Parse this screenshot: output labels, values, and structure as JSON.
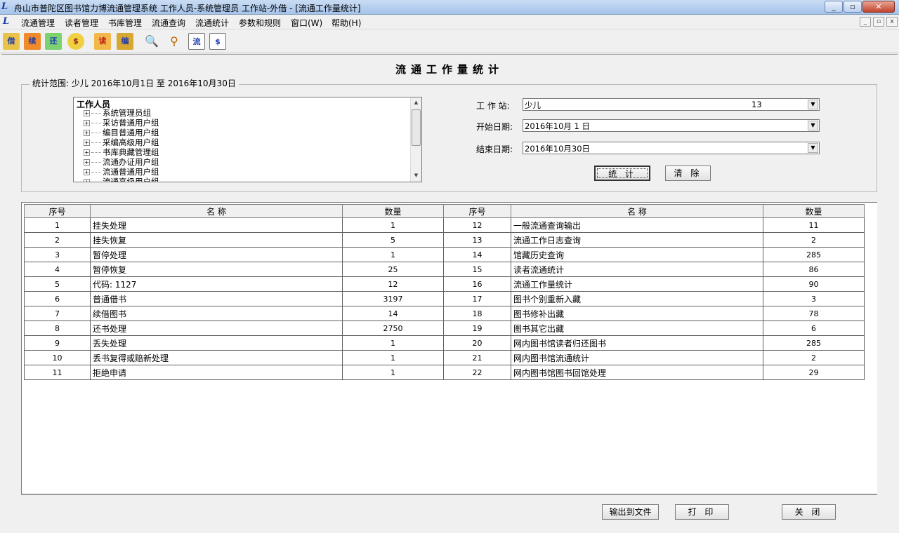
{
  "window": {
    "title": "舟山市普陀区图书馆力博流通管理系统 工作人员-系统管理员 工作站-外借 - [流通工作量统计]",
    "minimize": "_",
    "maximize": "▫",
    "close": "✕"
  },
  "menu": {
    "items": [
      "流通管理",
      "读者管理",
      "书库管理",
      "流通查询",
      "流通统计",
      "参数和规则",
      "窗口(W)",
      "帮助(H)"
    ]
  },
  "toolbar": {
    "icons": [
      "borrow-icon",
      "renew-icon",
      "return-icon",
      "fine-icon",
      "reader-register-icon",
      "catalog-icon",
      "search-icon",
      "finance-search-icon",
      "circulation-chart-icon",
      "money-chart-icon"
    ],
    "labels": [
      "借",
      "续",
      "还",
      "$",
      "读",
      "编",
      "",
      "",
      "流",
      "$"
    ]
  },
  "page": {
    "title": "流通工作量统计"
  },
  "range": {
    "legend": "统计范围:  少儿  2016年10月1日  至  2016年10月30日"
  },
  "tree": {
    "root": "工作人员",
    "items": [
      "系统管理员组",
      "采访普通用户组",
      "编目普通用户组",
      "采编高级用户组",
      "书库典藏管理组",
      "流通办证用户组",
      "流通普通用户组",
      "流通高级用户组"
    ]
  },
  "form": {
    "station_label": "工 作 站:",
    "station_value": "少儿",
    "station_code": "13",
    "start_label": "开始日期:",
    "start_value": "2016年10月 1 日",
    "end_label": "结束日期:",
    "end_value": "2016年10月30日",
    "stat_button": "统 计",
    "clear_button": "清 除"
  },
  "grid": {
    "headers": [
      "序号",
      "名    称",
      "数量",
      "序号",
      "名    称",
      "数量"
    ],
    "left_rows": [
      {
        "no": "1",
        "name": "挂失处理",
        "qty": "1"
      },
      {
        "no": "2",
        "name": "挂失恢复",
        "qty": "5"
      },
      {
        "no": "3",
        "name": "暂停处理",
        "qty": "1"
      },
      {
        "no": "4",
        "name": "暂停恢复",
        "qty": "25"
      },
      {
        "no": "5",
        "name": "代码: 1127",
        "qty": "12"
      },
      {
        "no": "6",
        "name": "普通借书",
        "qty": "3197"
      },
      {
        "no": "7",
        "name": "续借图书",
        "qty": "14"
      },
      {
        "no": "8",
        "name": "还书处理",
        "qty": "2750"
      },
      {
        "no": "9",
        "name": "丢失处理",
        "qty": "1"
      },
      {
        "no": "10",
        "name": "丢书复得或赔新处理",
        "qty": "1"
      },
      {
        "no": "11",
        "name": "拒绝申请",
        "qty": "1"
      }
    ],
    "right_rows": [
      {
        "no": "12",
        "name": "一般流通查询输出",
        "qty": "11"
      },
      {
        "no": "13",
        "name": "流通工作日志查询",
        "qty": "2"
      },
      {
        "no": "14",
        "name": "馆藏历史查询",
        "qty": "285"
      },
      {
        "no": "15",
        "name": "读者流通统计",
        "qty": "86"
      },
      {
        "no": "16",
        "name": "流通工作量统计",
        "qty": "90"
      },
      {
        "no": "17",
        "name": "图书个别重新入藏",
        "qty": "3"
      },
      {
        "no": "18",
        "name": "图书修补出藏",
        "qty": "78"
      },
      {
        "no": "19",
        "name": "图书其它出藏",
        "qty": "6"
      },
      {
        "no": "20",
        "name": "网内图书馆读者归还图书",
        "qty": "285"
      },
      {
        "no": "21",
        "name": "网内图书馆流通统计",
        "qty": "2"
      },
      {
        "no": "22",
        "name": "网内图书馆图书回馆处理",
        "qty": "29"
      }
    ]
  },
  "footer": {
    "export_button": "输出到文件",
    "print_button": "打 印",
    "close_button": "关 闭"
  }
}
